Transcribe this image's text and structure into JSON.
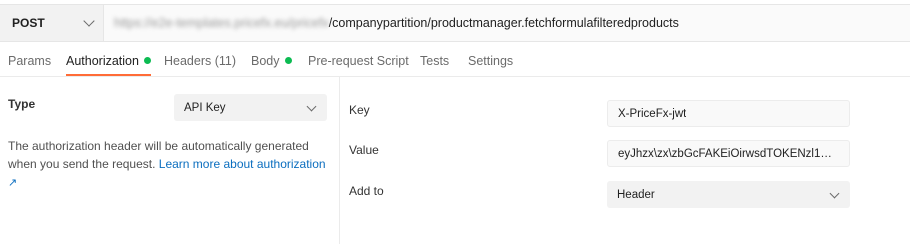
{
  "request": {
    "method": "POST",
    "url_hidden": "https://e2e-templates.pricefx.eu/pricefx",
    "url_path": "/companypartition/productmanager.fetchformulafilteredproducts"
  },
  "tabs": [
    {
      "label": "Params"
    },
    {
      "label": "Authorization"
    },
    {
      "label": "Headers (11)"
    },
    {
      "label": "Body"
    },
    {
      "label": "Pre-request Script"
    },
    {
      "label": "Tests"
    },
    {
      "label": "Settings"
    }
  ],
  "auth": {
    "type_label": "Type",
    "type_value": "API Key",
    "description": "The authorization header will be automatically generated when you send the request.",
    "learn_more": "Learn more about authorization",
    "learn_more_arrow": "↗",
    "key_label": "Key",
    "key_value": "X-PriceFx-jwt",
    "value_label": "Value",
    "value_value": "eyJhzx\\zx\\zbGcFAKEiOirwsdTOKENzl1NiJ9...",
    "addto_label": "Add to",
    "addto_value": "Header"
  },
  "colors": {
    "active_tab_underline": "#ff6c37",
    "status_dot": "#0cbb52",
    "link": "#0b6ebf"
  }
}
